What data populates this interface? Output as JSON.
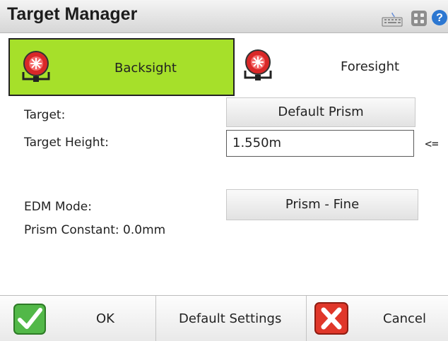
{
  "window": {
    "title": "Target Manager"
  },
  "title_icons": [
    "keyboard-icon",
    "grid-icon",
    "help-icon"
  ],
  "tabs": [
    {
      "label": "Backsight",
      "active": true,
      "icon": "prism-target-icon"
    },
    {
      "label": "Foresight",
      "active": false,
      "icon": "prism-target-icon"
    }
  ],
  "form": {
    "target_label": "Target:",
    "target_value": "Default Prism",
    "height_label": "Target Height:",
    "height_value": "1.550m",
    "height_button": "<=",
    "edm_label": "EDM Mode:",
    "edm_value": "Prism - Fine",
    "prism_constant": "Prism Constant: 0.0mm"
  },
  "footer": {
    "ok_label": "OK",
    "default_label": "Default Settings",
    "cancel_label": "Cancel"
  },
  "colors": {
    "active_tab": "#a6e02a",
    "ok_icon": "#3aa52e",
    "cancel_icon": "#d42a1c",
    "prism": "#e23b3b"
  }
}
